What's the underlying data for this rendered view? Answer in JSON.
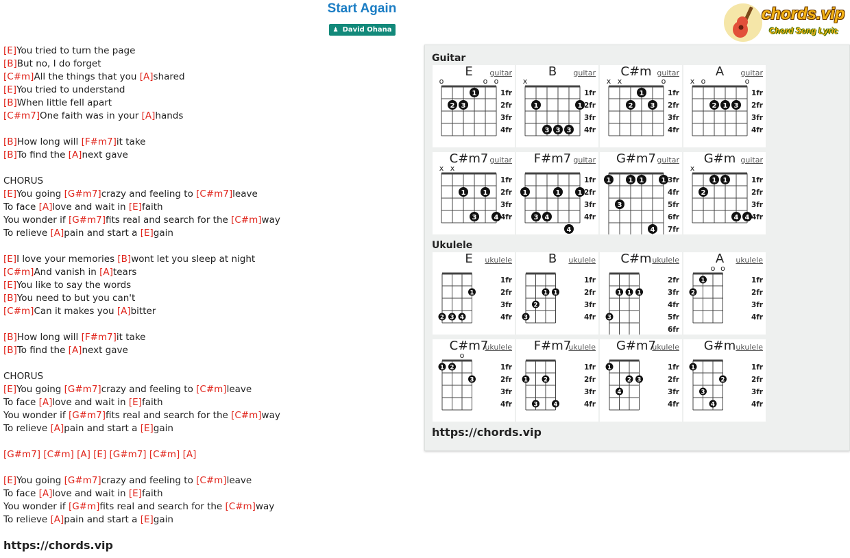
{
  "song": {
    "title": "Start Again",
    "artist": "David Ohana"
  },
  "site": {
    "logo_text": "chords.vip",
    "logo_tagline": "Chord Song Lyric",
    "footer_link": "https://chords.vip",
    "panel_link": "https://chords.vip"
  },
  "lyrics": [
    [
      "[E]",
      "You tried to turn the page"
    ],
    [
      "[B]",
      "But no, I do forget"
    ],
    [
      "[C#m]",
      "All the things that you ",
      "[A]",
      "shared"
    ],
    [
      "[E]",
      "You tried to understand"
    ],
    [
      "[B]",
      "When little fell apart"
    ],
    [
      "[C#m7]",
      "One faith was in your ",
      "[A]",
      "hands"
    ],
    [],
    [
      "[B]",
      "How long will ",
      "[F#m7]",
      "it take"
    ],
    [
      "[B]",
      "To find the ",
      "[A]",
      "next gave"
    ],
    [],
    [
      "CHORUS"
    ],
    [
      "[E]",
      "You going ",
      "[G#m7]",
      "crazy and feeling to ",
      "[C#m7]",
      "leave"
    ],
    [
      "To face ",
      "[A]",
      "love and wait in ",
      "[E]",
      "faith"
    ],
    [
      "You wonder if ",
      "[G#m7]",
      "fits real and search for the ",
      "[C#m]",
      "way"
    ],
    [
      "To relieve ",
      "[A]",
      "pain and start a ",
      "[E]",
      "gain"
    ],
    [],
    [
      "[E]",
      "I love your memories ",
      "[B]",
      "wont let you sleep at night"
    ],
    [
      "[C#m]",
      "And vanish in ",
      "[A]",
      "tears"
    ],
    [
      "[E]",
      "You like to say the words"
    ],
    [
      "[B]",
      "You need to but you can't"
    ],
    [
      "[C#m]",
      "Can it makes you ",
      "[A]",
      "bitter"
    ],
    [],
    [
      "[B]",
      "How long will ",
      "[F#m7]",
      "it take"
    ],
    [
      "[B]",
      "To find the ",
      "[A]",
      "next gave"
    ],
    [],
    [
      "CHORUS"
    ],
    [
      "[E]",
      "You going ",
      "[G#m7]",
      "crazy and feeling to ",
      "[C#m]",
      "leave"
    ],
    [
      "To face ",
      "[A]",
      "love and wait in ",
      "[E]",
      "faith"
    ],
    [
      "You wonder if ",
      "[G#m7]",
      "fits real and search for the ",
      "[C#m]",
      "way"
    ],
    [
      "To relieve ",
      "[A]",
      "pain and start a ",
      "[E]",
      "gain"
    ],
    [],
    [
      "[G#m7]",
      " ",
      "[C#m]",
      " ",
      "[A]",
      " ",
      "[E]",
      " ",
      "[G#m7]",
      " ",
      "[C#m]",
      " ",
      "[A]"
    ],
    [],
    [
      "[E]",
      "You going ",
      "[G#m7]",
      "crazy and feeling to ",
      "[C#m]",
      "leave"
    ],
    [
      "To face ",
      "[A]",
      "love and wait in ",
      "[E]",
      "faith"
    ],
    [
      "You wonder if ",
      "[G#m]",
      "fits real and search for the ",
      "[C#m]",
      "way"
    ],
    [
      "To relieve ",
      "[A]",
      "pain and start a ",
      "[E]",
      "gain"
    ]
  ],
  "panel": {
    "guitar_label": "Guitar",
    "ukulele_label": "Ukulele",
    "guitar_chords": [
      {
        "name": "E",
        "type": "guitar",
        "frets": [
          "1fr",
          "2fr",
          "3fr",
          "4fr"
        ],
        "top": [
          "o",
          "",
          "",
          "",
          "o",
          "o"
        ],
        "dots": [
          [
            3,
            1,
            "1"
          ],
          [
            1,
            2,
            "2"
          ],
          [
            2,
            2,
            "3"
          ]
        ]
      },
      {
        "name": "B",
        "type": "guitar",
        "frets": [
          "1fr",
          "2fr",
          "3fr",
          "4fr"
        ],
        "top": [
          "x",
          "",
          "",
          "",
          "",
          ""
        ],
        "dots": [
          [
            1,
            2,
            "1"
          ],
          [
            5,
            2,
            "1"
          ],
          [
            2,
            4,
            "3"
          ],
          [
            3,
            4,
            "3"
          ],
          [
            4,
            4,
            "3"
          ]
        ]
      },
      {
        "name": "C#m",
        "type": "guitar",
        "frets": [
          "1fr",
          "2fr",
          "3fr",
          "4fr"
        ],
        "top": [
          "x",
          "x",
          "",
          "",
          "",
          "o"
        ],
        "dots": [
          [
            3,
            1,
            "1"
          ],
          [
            2,
            2,
            "2"
          ],
          [
            4,
            2,
            "3"
          ]
        ]
      },
      {
        "name": "A",
        "type": "guitar",
        "frets": [
          "1fr",
          "2fr",
          "3fr",
          "4fr"
        ],
        "top": [
          "x",
          "o",
          "",
          "",
          "",
          "o"
        ],
        "dots": [
          [
            2,
            2,
            "2"
          ],
          [
            3,
            2,
            "1"
          ],
          [
            4,
            2,
            "3"
          ]
        ]
      },
      {
        "name": "C#m7",
        "type": "guitar",
        "frets": [
          "1fr",
          "2fr",
          "3fr",
          "4fr"
        ],
        "top": [
          "x",
          "x",
          "",
          "",
          "",
          ""
        ],
        "dots": [
          [
            2,
            2,
            "1"
          ],
          [
            4,
            2,
            "1"
          ],
          [
            3,
            4,
            "3"
          ],
          [
            5,
            4,
            "4"
          ]
        ]
      },
      {
        "name": "F#m7",
        "type": "guitar",
        "frets": [
          "1fr",
          "2fr",
          "3fr",
          "4fr"
        ],
        "top": [
          "",
          "",
          "",
          "",
          "",
          ""
        ],
        "dots": [
          [
            0,
            2,
            "1"
          ],
          [
            3,
            2,
            "1"
          ],
          [
            5,
            2,
            "1"
          ],
          [
            1,
            4,
            "3"
          ],
          [
            2,
            4,
            "4"
          ],
          [
            4,
            5,
            "4"
          ]
        ]
      },
      {
        "name": "G#m7",
        "type": "guitar",
        "frets": [
          "3fr",
          "4fr",
          "5fr",
          "6fr",
          "7fr"
        ],
        "top": [
          "",
          "",
          "",
          "",
          "",
          ""
        ],
        "dots": [
          [
            0,
            1,
            "1"
          ],
          [
            2,
            1,
            "1"
          ],
          [
            3,
            1,
            "1"
          ],
          [
            5,
            1,
            "1"
          ],
          [
            1,
            3,
            "3"
          ],
          [
            4,
            5,
            "4"
          ]
        ]
      },
      {
        "name": "G#m",
        "type": "guitar",
        "frets": [
          "1fr",
          "2fr",
          "3fr",
          "4fr"
        ],
        "top": [
          "x",
          "",
          "",
          "",
          "",
          ""
        ],
        "dots": [
          [
            2,
            1,
            "1"
          ],
          [
            3,
            1,
            "1"
          ],
          [
            1,
            2,
            "2"
          ],
          [
            4,
            4,
            "4"
          ],
          [
            5,
            4,
            "4"
          ]
        ]
      }
    ],
    "ukulele_chords": [
      {
        "name": "E",
        "type": "ukulele",
        "frets": [
          "1fr",
          "2fr",
          "3fr",
          "4fr"
        ],
        "top": [
          "",
          "",
          "",
          ""
        ],
        "dots": [
          [
            3,
            2,
            "1"
          ],
          [
            0,
            4,
            "2"
          ],
          [
            1,
            4,
            "3"
          ],
          [
            2,
            4,
            "4"
          ]
        ]
      },
      {
        "name": "B",
        "type": "ukulele",
        "frets": [
          "1fr",
          "2fr",
          "3fr",
          "4fr"
        ],
        "top": [
          "",
          "",
          "",
          ""
        ],
        "dots": [
          [
            2,
            2,
            "1"
          ],
          [
            3,
            2,
            "1"
          ],
          [
            1,
            3,
            "2"
          ],
          [
            0,
            4,
            "3"
          ]
        ]
      },
      {
        "name": "C#m",
        "type": "ukulele",
        "frets": [
          "2fr",
          "3fr",
          "4fr",
          "5fr",
          "6fr"
        ],
        "top": [
          "",
          "",
          "",
          ""
        ],
        "dots": [
          [
            1,
            2,
            "1"
          ],
          [
            2,
            2,
            "1"
          ],
          [
            3,
            2,
            "1"
          ],
          [
            0,
            4,
            "3"
          ]
        ]
      },
      {
        "name": "A",
        "type": "ukulele",
        "frets": [
          "1fr",
          "2fr",
          "3fr",
          "4fr"
        ],
        "top": [
          "",
          "",
          "o",
          "o"
        ],
        "dots": [
          [
            1,
            1,
            "1"
          ],
          [
            0,
            2,
            "2"
          ]
        ]
      },
      {
        "name": "C#m7",
        "type": "ukulele",
        "frets": [
          "1fr",
          "2fr",
          "3fr",
          "4fr"
        ],
        "top": [
          "",
          "",
          "o",
          ""
        ],
        "dots": [
          [
            0,
            1,
            "1"
          ],
          [
            1,
            1,
            "2"
          ],
          [
            3,
            2,
            "3"
          ]
        ]
      },
      {
        "name": "F#m7",
        "type": "ukulele",
        "frets": [
          "1fr",
          "2fr",
          "3fr",
          "4fr"
        ],
        "top": [
          "",
          "",
          "",
          ""
        ],
        "dots": [
          [
            0,
            2,
            "1"
          ],
          [
            2,
            2,
            "2"
          ],
          [
            1,
            4,
            "3"
          ],
          [
            3,
            4,
            "4"
          ]
        ]
      },
      {
        "name": "G#m7",
        "type": "ukulele",
        "frets": [
          "1fr",
          "2fr",
          "3fr",
          "4fr"
        ],
        "top": [
          "",
          "",
          "",
          ""
        ],
        "dots": [
          [
            0,
            1,
            "1"
          ],
          [
            2,
            2,
            "2"
          ],
          [
            3,
            2,
            "3"
          ],
          [
            1,
            3,
            "4"
          ]
        ]
      },
      {
        "name": "G#m",
        "type": "ukulele",
        "frets": [
          "1fr",
          "2fr",
          "3fr",
          "4fr"
        ],
        "top": [
          "",
          "",
          "",
          ""
        ],
        "dots": [
          [
            0,
            1,
            "1"
          ],
          [
            3,
            2,
            "2"
          ],
          [
            1,
            3,
            "3"
          ],
          [
            2,
            4,
            "4"
          ]
        ]
      }
    ]
  }
}
